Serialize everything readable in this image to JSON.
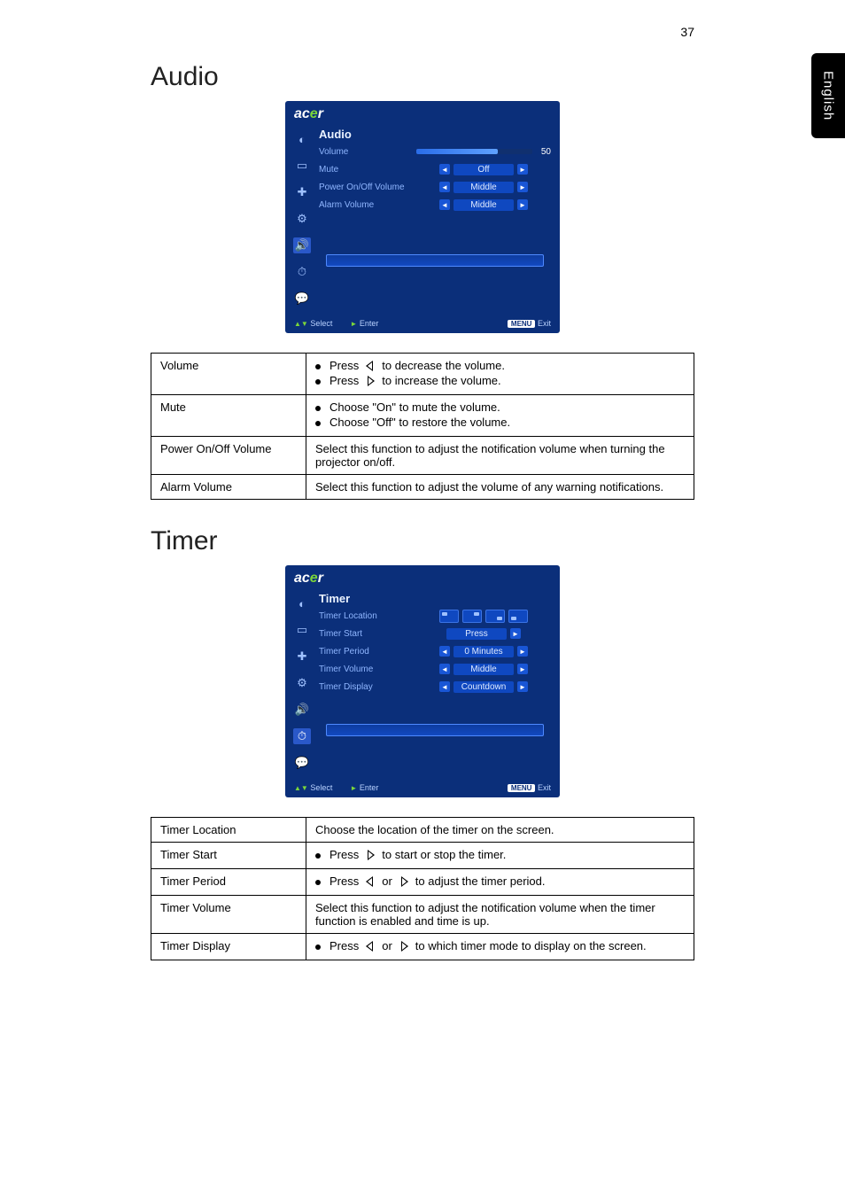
{
  "page_number": "37",
  "side_tab": "English",
  "logo_text_1": "ac",
  "logo_text_2": "e",
  "logo_text_3": "r",
  "audio": {
    "heading": "Audio",
    "osd": {
      "title": "Audio",
      "rows": {
        "volume_label": "Volume",
        "volume_value": "50",
        "mute_label": "Mute",
        "mute_value": "Off",
        "power_label": "Power On/Off Volume",
        "power_value": "Middle",
        "alarm_label": "Alarm Volume",
        "alarm_value": "Middle"
      },
      "footer": {
        "select": "Select",
        "enter": "Enter",
        "menu": "MENU",
        "exit": "Exit"
      }
    },
    "table": {
      "volume": {
        "key": "Volume",
        "line1a": "Press",
        "line1b": "to decrease the volume.",
        "line2a": "Press",
        "line2b": "to increase the volume."
      },
      "mute": {
        "key": "Mute",
        "line1": "Choose \"On\" to mute the volume.",
        "line2": "Choose \"Off\" to restore the volume."
      },
      "power": {
        "key": "Power On/Off Volume",
        "line1": "Select this function to adjust the notification volume when turning the projector on/off."
      },
      "alarm": {
        "key": "Alarm Volume",
        "line1": "Select this function to adjust the volume of any warning notifications."
      }
    }
  },
  "timer": {
    "heading": "Timer",
    "osd": {
      "title": "Timer",
      "rows": {
        "location_label": "Timer Location",
        "start_label": "Timer Start",
        "start_value": "Press",
        "period_label": "Timer Period",
        "period_value": "0   Minutes",
        "volume_label": "Timer Volume",
        "volume_value": "Middle",
        "display_label": "Timer Display",
        "display_value": "Countdown"
      },
      "footer": {
        "select": "Select",
        "enter": "Enter",
        "menu": "MENU",
        "exit": "Exit"
      }
    },
    "table": {
      "location": {
        "key": "Timer Location",
        "val": "Choose the location of the timer on the screen."
      },
      "start": {
        "key": "Timer Start",
        "a": "Press",
        "b": "to start or stop the timer."
      },
      "period": {
        "key": "Timer Period",
        "a": "Press",
        "b": "or",
        "c": "to adjust the timer period."
      },
      "volume": {
        "key": "Timer Volume",
        "val": "Select this function to adjust the notification volume when the timer function is enabled and time is up."
      },
      "display": {
        "key": "Timer Display",
        "a": "Press",
        "b": "or",
        "c": "to which timer mode to display on the screen."
      }
    }
  }
}
